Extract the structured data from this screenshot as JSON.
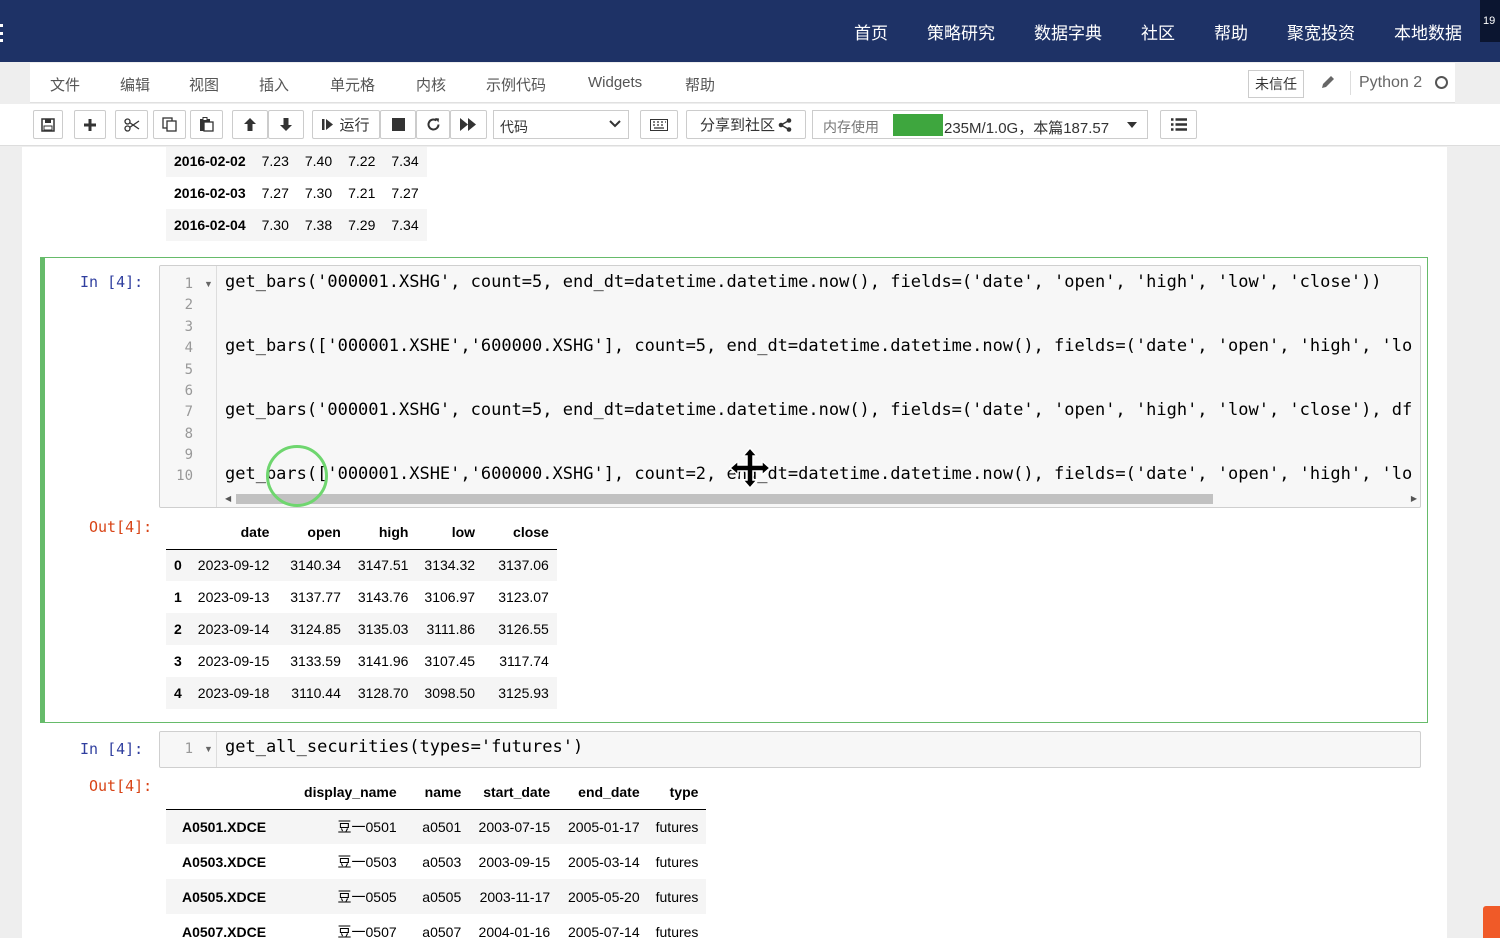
{
  "topnav": {
    "items": [
      "首页",
      "策略研究",
      "数据字典",
      "社区",
      "帮助",
      "聚宽投资",
      "本地数据"
    ],
    "corner_badge": "19"
  },
  "menubar": {
    "items": [
      "文件",
      "编辑",
      "视图",
      "插入",
      "单元格",
      "内核",
      "示例代码",
      "Widgets",
      "帮助"
    ],
    "untrusted_label": "未信任",
    "kernel_name": "Python 2"
  },
  "toolbar": {
    "run_label": "运行",
    "cell_type": "代码",
    "share_label": "分享到社区",
    "memory_label": "内存使用",
    "memory_text": "235M/1.0G，本篇187.57",
    "memory_fill_fraction": 0.2
  },
  "prev_output": {
    "rows": [
      [
        "2016-02-02",
        "7.23",
        "7.40",
        "7.22",
        "7.34"
      ],
      [
        "2016-02-03",
        "7.27",
        "7.30",
        "7.21",
        "7.27"
      ],
      [
        "2016-02-04",
        "7.30",
        "7.38",
        "7.29",
        "7.34"
      ]
    ]
  },
  "cell1": {
    "in_prompt": "In  [4]:",
    "out_prompt": "Out[4]:",
    "line_numbers": [
      "1",
      "2",
      "3",
      "4",
      "5",
      "6",
      "7",
      "8",
      "9",
      "10"
    ],
    "lines": [
      "get_bars('000001.XSHG', count=5, end_dt=datetime.datetime.now(), fields=('date', 'open', 'high', 'low', 'close'))",
      "",
      "",
      "get_bars(['000001.XSHE','600000.XSHG'], count=5, end_dt=datetime.datetime.now(), fields=('date', 'open', 'high', 'lo",
      "",
      "",
      "get_bars('000001.XSHG', count=5, end_dt=datetime.datetime.now(), fields=('date', 'open', 'high', 'low', 'close'), df",
      "",
      "",
      "get_bars(['000001.XSHE','600000.XSHG'], count=2, end_dt=datetime.datetime.now(), fields=('date', 'open', 'high', 'lo"
    ],
    "output": {
      "columns": [
        "",
        "date",
        "open",
        "high",
        "low",
        "close"
      ],
      "rows": [
        [
          "0",
          "2023-09-12",
          "3140.34",
          "3147.51",
          "3134.32",
          "3137.06"
        ],
        [
          "1",
          "2023-09-13",
          "3137.77",
          "3143.76",
          "3106.97",
          "3123.07"
        ],
        [
          "2",
          "2023-09-14",
          "3124.85",
          "3135.03",
          "3111.86",
          "3126.55"
        ],
        [
          "3",
          "2023-09-15",
          "3133.59",
          "3141.96",
          "3107.45",
          "3117.74"
        ],
        [
          "4",
          "2023-09-18",
          "3110.44",
          "3128.70",
          "3098.50",
          "3125.93"
        ]
      ]
    }
  },
  "cell2": {
    "in_prompt": "In  [4]:",
    "out_prompt": "Out[4]:",
    "line_number": "1",
    "code": "get_all_securities(types='futures')",
    "output": {
      "columns": [
        "",
        "display_name",
        "name",
        "start_date",
        "end_date",
        "type"
      ],
      "rows": [
        [
          "A0501.XDCE",
          "豆一0501",
          "a0501",
          "2003-07-15",
          "2005-01-17",
          "futures"
        ],
        [
          "A0503.XDCE",
          "豆一0503",
          "a0503",
          "2003-09-15",
          "2005-03-14",
          "futures"
        ],
        [
          "A0505.XDCE",
          "豆一0505",
          "a0505",
          "2003-11-17",
          "2005-05-20",
          "futures"
        ],
        [
          "A0507.XDCE",
          "豆一0507",
          "a0507",
          "2004-01-16",
          "2005-07-14",
          "futures"
        ]
      ]
    }
  }
}
